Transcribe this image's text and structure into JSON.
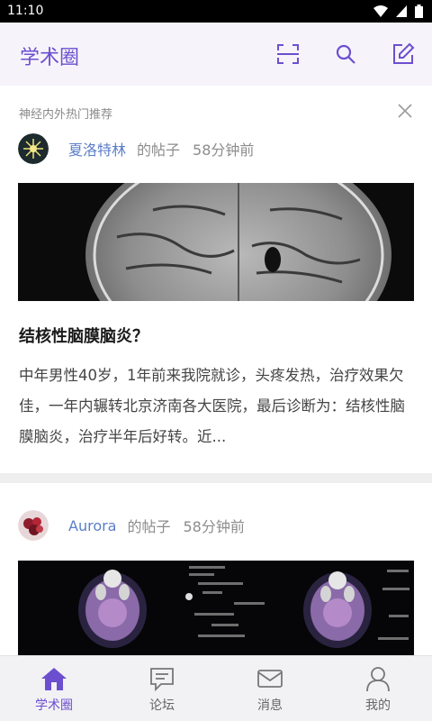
{
  "status_bar": {
    "time": "11:10"
  },
  "header": {
    "title": "学术圈"
  },
  "recommend": {
    "label": "神经内外热门推荐"
  },
  "posts": [
    {
      "author": "夏洛特林",
      "suffix": "的帖子",
      "time": "58分钟前",
      "title": "结核性脑膜脑炎？",
      "excerpt": "中年男性40岁，1年前来我院就诊，头疼发热，治疗效果欠佳，一年内辗转北京济南各大医院，最后诊断为：结核性脑膜脑炎，治疗半年后好转。近..."
    },
    {
      "author": "Aurora",
      "suffix": "的帖子",
      "time": "58分钟前"
    }
  ],
  "nav": [
    {
      "label": "学术圈",
      "icon": "home-icon"
    },
    {
      "label": "论坛",
      "icon": "forum-icon"
    },
    {
      "label": "消息",
      "icon": "mail-icon"
    },
    {
      "label": "我的",
      "icon": "user-icon"
    }
  ],
  "colors": {
    "accent": "#6c4fcf",
    "author_link": "#5b7ec9"
  }
}
